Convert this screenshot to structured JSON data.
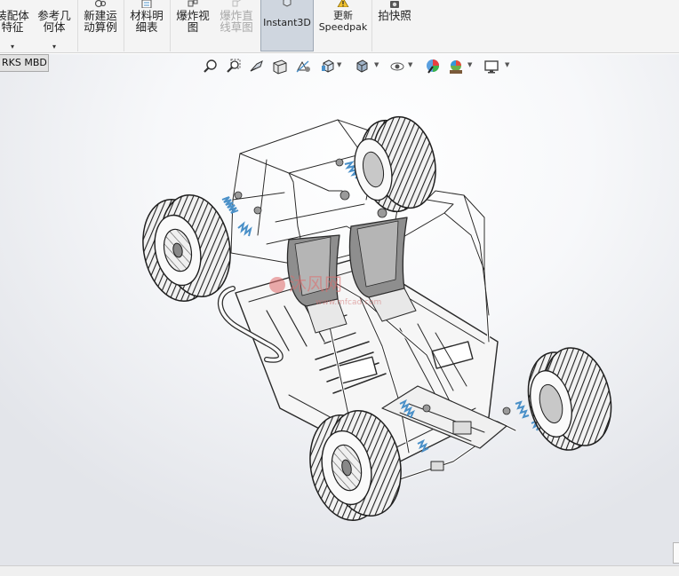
{
  "ribbon": {
    "items": [
      {
        "id": "mate",
        "line1": "装配体",
        "line2": "特征",
        "icon": "assembly-feature-icon",
        "has_dropdown": true
      },
      {
        "id": "refgeom",
        "line1": "参考几",
        "line2": "何体",
        "icon": "reference-geometry-icon",
        "has_dropdown": true
      },
      {
        "id": "motion",
        "line1": "新建运",
        "line2": "动算例",
        "icon": "motion-study-icon"
      },
      {
        "id": "bom",
        "line1": "材料明",
        "line2": "细表",
        "icon": "bill-of-materials-icon"
      },
      {
        "id": "explode",
        "line1": "爆炸视",
        "line2": "图",
        "icon": "exploded-view-icon"
      },
      {
        "id": "explodeline",
        "line1": "爆炸直",
        "line2": "线草图",
        "icon": "explode-line-sketch-icon",
        "disabled": true
      },
      {
        "id": "instant3d",
        "line1": "Instant3D",
        "line2": "",
        "icon": "instant3d-icon",
        "active": true
      },
      {
        "id": "speedpak",
        "line1": "更新",
        "line2": "Speedpak",
        "icon": "speedpak-warning-icon"
      },
      {
        "id": "snapshot",
        "line1": "拍快照",
        "line2": "",
        "icon": "camera-icon"
      }
    ]
  },
  "tab": {
    "label": "RKS MBD"
  },
  "hud": {
    "icons": [
      "zoom-to-fit-icon",
      "zoom-to-area-icon",
      "previous-view-icon",
      "section-view-icon",
      "dynamic-annotation-icon",
      "view-orientation-icon",
      "display-style-icon",
      "hide-show-items-icon",
      "edit-appearance-icon",
      "apply-scene-icon",
      "view-settings-icon"
    ]
  },
  "watermark": {
    "line1": "沐风网",
    "line2": "www.mfcad.com"
  },
  "colors": {
    "accent_blue": "#4a90c8",
    "spring_blue": "#5aa0cc",
    "ribbon_bg": "#f4f4f4",
    "active_button_bg": "#cfd6df",
    "watermark_red": "#e06a6a",
    "frame_stroke": "#2a2a2a"
  }
}
